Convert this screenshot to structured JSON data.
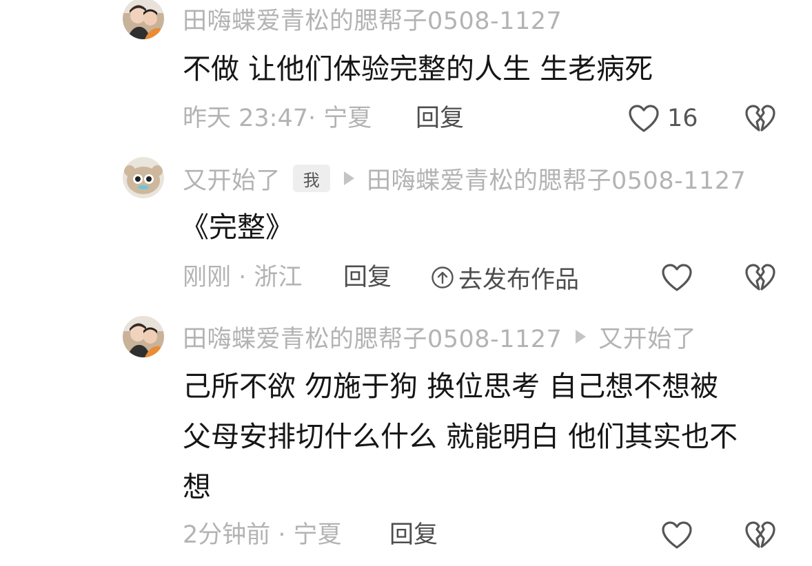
{
  "comments": [
    {
      "author": "田嗨蝶爱青松的腮帮子0508-1127",
      "text_lines": [
        "不做 让他们体验完整的人生 生老病死"
      ],
      "time_location": "昨天 23:47· 宁夏",
      "reply_label": "回复",
      "like_count": "16",
      "like_icon": "heart-outline-icon",
      "dislike_icon": "broken-heart-icon"
    },
    {
      "author": "又开始了",
      "author_badge": "我",
      "reply_to": "田嗨蝶爱青松的腮帮子0508-1127",
      "text_lines": [
        "《完整》"
      ],
      "time_location": "刚刚 · 浙江",
      "reply_label": "回复",
      "publish_label": "去发布作品",
      "publish_icon": "upload-circle-icon",
      "like_icon": "heart-outline-icon",
      "dislike_icon": "broken-heart-icon"
    },
    {
      "author": "田嗨蝶爱青松的腮帮子0508-1127",
      "reply_to": "又开始了",
      "text_lines": [
        "己所不欲 勿施于狗 换位思考 自己想不想被",
        "父母安排切什么什么 就能明白 他们其实也不",
        "想"
      ],
      "time_location": "2分钟前 · 宁夏",
      "reply_label": "回复",
      "like_icon": "heart-outline-icon",
      "dislike_icon": "broken-heart-icon"
    }
  ],
  "colors": {
    "meta_gray": "#b3b3b3",
    "text_dark": "#161616",
    "action_gray": "#4d4d4d",
    "icon_gray": "#555555"
  }
}
